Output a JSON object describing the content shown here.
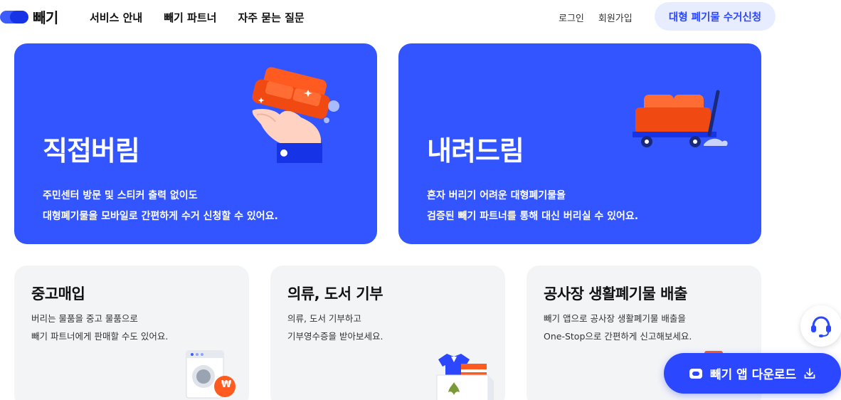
{
  "header": {
    "logo_text": "빼기",
    "nav": [
      "서비스 안내",
      "빼기 파트너",
      "자주 묻는 질문"
    ],
    "login": "로그인",
    "signup": "회원가입",
    "cta": "대형 폐기물 수거신청"
  },
  "big_cards": [
    {
      "title": "직접버림",
      "desc": [
        "주민센터 방문 및 스티커 출력 없이도",
        "대형폐기물을 모바일로 간편하게 수거 신청할 수 있어요."
      ],
      "icon": "hand-holding-sofa-icon"
    },
    {
      "title": "내려드림",
      "desc": [
        "혼자 버리기 어려운 대형폐기물을",
        "검증된 빼기 파트너를 통해 대신 버리실 수 있어요."
      ],
      "icon": "sofa-cart-icon"
    }
  ],
  "small_cards": [
    {
      "title": "중고매입",
      "desc": [
        "버리는 물품을 중고 물품으로",
        "빼기 파트너에게 판매할 수도 있어요."
      ],
      "icon": "washing-machine-won-icon"
    },
    {
      "title": "의류, 도서 기부",
      "desc": [
        "의류, 도서 기부하고",
        "기부영수증을 받아보세요."
      ],
      "icon": "donation-box-icon"
    },
    {
      "title": "공사장 생활폐기물 배출",
      "desc": [
        "빼기 앱으로 공사장 생활폐기물 배출을",
        "One-Stop으로 간편하게 신고해보세요."
      ],
      "icon": "construction-waste-icon"
    }
  ],
  "floating": {
    "download": "빼기 앱 다운로드",
    "won_symbol": "₩"
  },
  "colors": {
    "brand_blue": "#3355ff",
    "cta_blue": "#2b47ff",
    "light_blue": "#e8ecff",
    "card_gray": "#f3f4f6",
    "accent_orange": "#ff5a1f"
  }
}
